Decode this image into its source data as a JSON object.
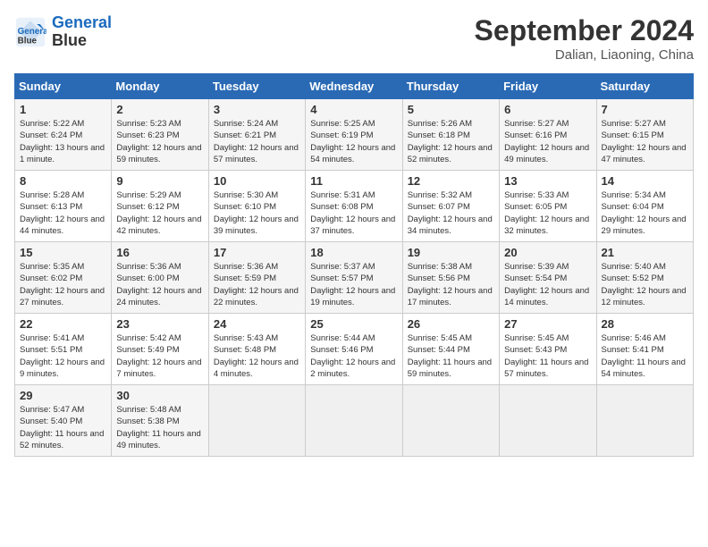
{
  "header": {
    "logo_line1": "General",
    "logo_line2": "Blue",
    "month": "September 2024",
    "location": "Dalian, Liaoning, China"
  },
  "weekdays": [
    "Sunday",
    "Monday",
    "Tuesday",
    "Wednesday",
    "Thursday",
    "Friday",
    "Saturday"
  ],
  "weeks": [
    [
      {
        "day": "1",
        "sunrise": "Sunrise: 5:22 AM",
        "sunset": "Sunset: 6:24 PM",
        "daylight": "Daylight: 13 hours and 1 minute."
      },
      {
        "day": "2",
        "sunrise": "Sunrise: 5:23 AM",
        "sunset": "Sunset: 6:23 PM",
        "daylight": "Daylight: 12 hours and 59 minutes."
      },
      {
        "day": "3",
        "sunrise": "Sunrise: 5:24 AM",
        "sunset": "Sunset: 6:21 PM",
        "daylight": "Daylight: 12 hours and 57 minutes."
      },
      {
        "day": "4",
        "sunrise": "Sunrise: 5:25 AM",
        "sunset": "Sunset: 6:19 PM",
        "daylight": "Daylight: 12 hours and 54 minutes."
      },
      {
        "day": "5",
        "sunrise": "Sunrise: 5:26 AM",
        "sunset": "Sunset: 6:18 PM",
        "daylight": "Daylight: 12 hours and 52 minutes."
      },
      {
        "day": "6",
        "sunrise": "Sunrise: 5:27 AM",
        "sunset": "Sunset: 6:16 PM",
        "daylight": "Daylight: 12 hours and 49 minutes."
      },
      {
        "day": "7",
        "sunrise": "Sunrise: 5:27 AM",
        "sunset": "Sunset: 6:15 PM",
        "daylight": "Daylight: 12 hours and 47 minutes."
      }
    ],
    [
      {
        "day": "8",
        "sunrise": "Sunrise: 5:28 AM",
        "sunset": "Sunset: 6:13 PM",
        "daylight": "Daylight: 12 hours and 44 minutes."
      },
      {
        "day": "9",
        "sunrise": "Sunrise: 5:29 AM",
        "sunset": "Sunset: 6:12 PM",
        "daylight": "Daylight: 12 hours and 42 minutes."
      },
      {
        "day": "10",
        "sunrise": "Sunrise: 5:30 AM",
        "sunset": "Sunset: 6:10 PM",
        "daylight": "Daylight: 12 hours and 39 minutes."
      },
      {
        "day": "11",
        "sunrise": "Sunrise: 5:31 AM",
        "sunset": "Sunset: 6:08 PM",
        "daylight": "Daylight: 12 hours and 37 minutes."
      },
      {
        "day": "12",
        "sunrise": "Sunrise: 5:32 AM",
        "sunset": "Sunset: 6:07 PM",
        "daylight": "Daylight: 12 hours and 34 minutes."
      },
      {
        "day": "13",
        "sunrise": "Sunrise: 5:33 AM",
        "sunset": "Sunset: 6:05 PM",
        "daylight": "Daylight: 12 hours and 32 minutes."
      },
      {
        "day": "14",
        "sunrise": "Sunrise: 5:34 AM",
        "sunset": "Sunset: 6:04 PM",
        "daylight": "Daylight: 12 hours and 29 minutes."
      }
    ],
    [
      {
        "day": "15",
        "sunrise": "Sunrise: 5:35 AM",
        "sunset": "Sunset: 6:02 PM",
        "daylight": "Daylight: 12 hours and 27 minutes."
      },
      {
        "day": "16",
        "sunrise": "Sunrise: 5:36 AM",
        "sunset": "Sunset: 6:00 PM",
        "daylight": "Daylight: 12 hours and 24 minutes."
      },
      {
        "day": "17",
        "sunrise": "Sunrise: 5:36 AM",
        "sunset": "Sunset: 5:59 PM",
        "daylight": "Daylight: 12 hours and 22 minutes."
      },
      {
        "day": "18",
        "sunrise": "Sunrise: 5:37 AM",
        "sunset": "Sunset: 5:57 PM",
        "daylight": "Daylight: 12 hours and 19 minutes."
      },
      {
        "day": "19",
        "sunrise": "Sunrise: 5:38 AM",
        "sunset": "Sunset: 5:56 PM",
        "daylight": "Daylight: 12 hours and 17 minutes."
      },
      {
        "day": "20",
        "sunrise": "Sunrise: 5:39 AM",
        "sunset": "Sunset: 5:54 PM",
        "daylight": "Daylight: 12 hours and 14 minutes."
      },
      {
        "day": "21",
        "sunrise": "Sunrise: 5:40 AM",
        "sunset": "Sunset: 5:52 PM",
        "daylight": "Daylight: 12 hours and 12 minutes."
      }
    ],
    [
      {
        "day": "22",
        "sunrise": "Sunrise: 5:41 AM",
        "sunset": "Sunset: 5:51 PM",
        "daylight": "Daylight: 12 hours and 9 minutes."
      },
      {
        "day": "23",
        "sunrise": "Sunrise: 5:42 AM",
        "sunset": "Sunset: 5:49 PM",
        "daylight": "Daylight: 12 hours and 7 minutes."
      },
      {
        "day": "24",
        "sunrise": "Sunrise: 5:43 AM",
        "sunset": "Sunset: 5:48 PM",
        "daylight": "Daylight: 12 hours and 4 minutes."
      },
      {
        "day": "25",
        "sunrise": "Sunrise: 5:44 AM",
        "sunset": "Sunset: 5:46 PM",
        "daylight": "Daylight: 12 hours and 2 minutes."
      },
      {
        "day": "26",
        "sunrise": "Sunrise: 5:45 AM",
        "sunset": "Sunset: 5:44 PM",
        "daylight": "Daylight: 11 hours and 59 minutes."
      },
      {
        "day": "27",
        "sunrise": "Sunrise: 5:45 AM",
        "sunset": "Sunset: 5:43 PM",
        "daylight": "Daylight: 11 hours and 57 minutes."
      },
      {
        "day": "28",
        "sunrise": "Sunrise: 5:46 AM",
        "sunset": "Sunset: 5:41 PM",
        "daylight": "Daylight: 11 hours and 54 minutes."
      }
    ],
    [
      {
        "day": "29",
        "sunrise": "Sunrise: 5:47 AM",
        "sunset": "Sunset: 5:40 PM",
        "daylight": "Daylight: 11 hours and 52 minutes."
      },
      {
        "day": "30",
        "sunrise": "Sunrise: 5:48 AM",
        "sunset": "Sunset: 5:38 PM",
        "daylight": "Daylight: 11 hours and 49 minutes."
      },
      null,
      null,
      null,
      null,
      null
    ]
  ]
}
